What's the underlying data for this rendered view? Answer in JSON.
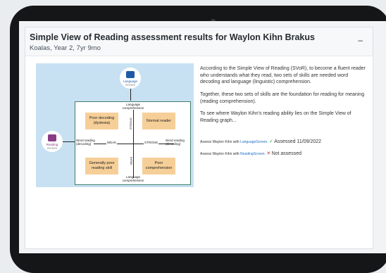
{
  "header": {
    "title": "Simple View of Reading assessment results for Waylon Kihn Brakus",
    "subtitle": "Koalas, Year 2, 7yr 9mo",
    "collapse_label": "–"
  },
  "diagram": {
    "language_screen": {
      "line1": "Language",
      "line2": "Screen"
    },
    "reading_screen": {
      "line1": "Reading",
      "line2": "Screen"
    },
    "top_label": {
      "line1": "Language",
      "line2": "comprehension"
    },
    "bottom_label": {
      "line1": "Language",
      "line2": "comprehension"
    },
    "left_label": {
      "line1": "Word reading",
      "line2": "(decoding)"
    },
    "right_label": {
      "line1": "Word reading",
      "line2": "(decoding)"
    },
    "weak_h": "WEAK",
    "strong_h": "STRONG",
    "strong_v": "STRONG",
    "weak_v": "WEAK",
    "quadrants": {
      "top_left": {
        "line1": "Poor decoding",
        "line2": "(dyslexia)"
      },
      "top_right": {
        "line1": "Normal reader",
        "line2": ""
      },
      "bottom_left": {
        "line1": "Generally poor",
        "line2": "reading skill"
      },
      "bottom_right": {
        "line1": "Poor",
        "line2": "comprehension"
      }
    },
    "colors": {
      "background": "#c7e1f3",
      "quadrant": "#f6cf98",
      "border": "#3f7d6a"
    }
  },
  "info": {
    "p1": "According to the Simple View of Reading (SVoR), to become a fluent reader who understands what they read, two sets of skills are needed word decoding and language (linguistic) comprehension.",
    "p2": "Together, these two sets of skills are the foundation for reading for meaning (reading comprehension).",
    "p3": "To see where Waylon Kihn's reading ability lies on the Simple View of Reading graph..."
  },
  "assessments": [
    {
      "prefix": "Assess Waylon Kihn with",
      "link": "LanguageScreen.",
      "icon": "✓",
      "status": "Assessed 11/09/2022"
    },
    {
      "prefix": "Assess Waylon Kihn with",
      "link": "ReadingScreen.",
      "icon": "✕",
      "status": "Not assessed"
    }
  ]
}
